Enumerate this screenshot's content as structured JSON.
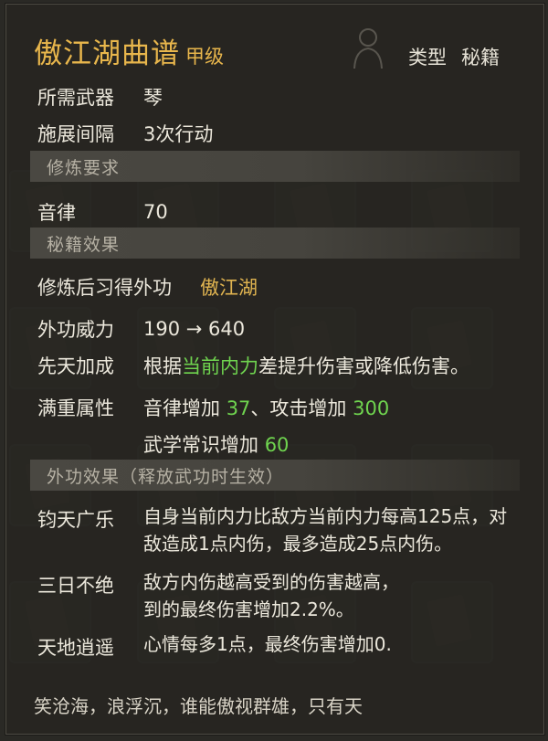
{
  "skill": {
    "name": "傲江湖曲谱",
    "grade": "甲级",
    "type_label": "类型",
    "type_value": "秘籍"
  },
  "basic": [
    {
      "label": "所需武器",
      "value": "琴"
    },
    {
      "label": "施展间隔",
      "value": "3次行动"
    }
  ],
  "section_requirements": "修炼要求",
  "requirement": {
    "label": "音律",
    "value": "70"
  },
  "section_effects": "秘籍效果",
  "learn": {
    "label": "修炼后习得外功",
    "value": "傲江湖"
  },
  "power": {
    "label": "外功威力",
    "value": "190 → 640"
  },
  "innate": {
    "label": "先天加成",
    "pre": "根据",
    "highlight": "当前内力",
    "post": "差提升伤害或降低伤害。"
  },
  "full_attr": {
    "label": "满重属性",
    "line1_a": "音律增加",
    "line1_a_val": "37",
    "line1_sep": "、攻击增加",
    "line1_b_val": "300",
    "line2": "武学常识增加",
    "line2_val": "60"
  },
  "section_ext": "外功效果（释放武功时生效）",
  "effects": [
    {
      "label": "钧天广乐",
      "line1": "自身当前内力比敌方当前内力每高125点，对",
      "line2": "敌造成1点内伤，最多造成25点内伤。"
    },
    {
      "label": "三日不绝",
      "line1": "敌方内伤越高受到的伤害越高，",
      "line2": "到的最终伤害增加2.2%。"
    },
    {
      "label": "天地逍遥",
      "line1": "心情每多1点，最终伤害增加0.",
      "line2": ""
    }
  ],
  "bottom_line": "笑沧海，浪浮沉，谁能傲视群雄，只有天"
}
